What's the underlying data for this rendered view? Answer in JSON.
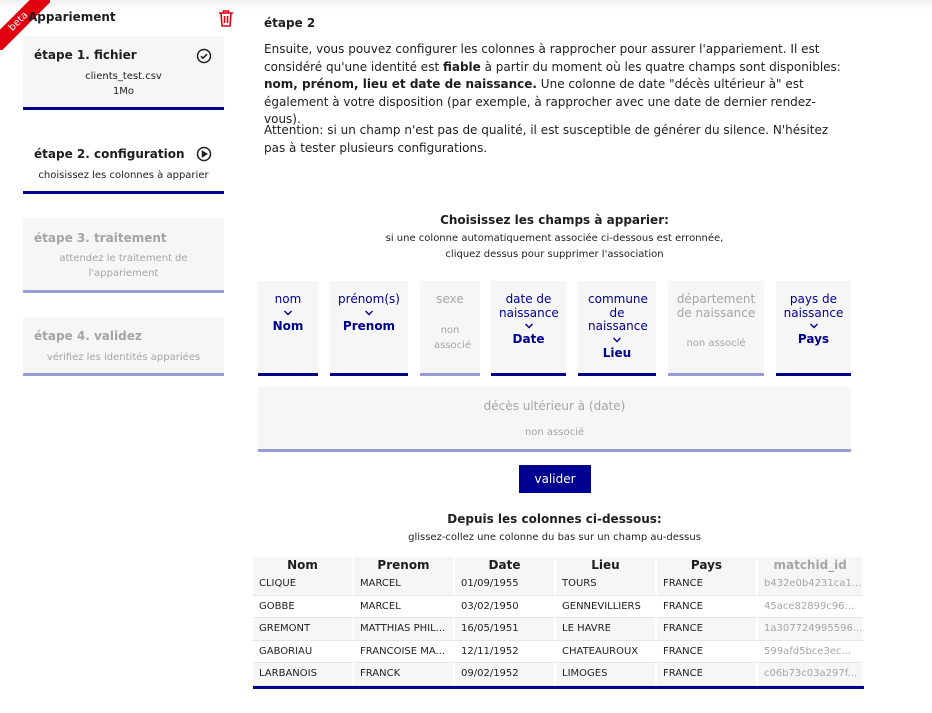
{
  "banner": {
    "beta": "beta"
  },
  "sidebar": {
    "title": "Appariement",
    "steps": [
      {
        "title": "étape 1. fichier",
        "line1": "clients_test.csv",
        "line2": "1Mo",
        "status": "done"
      },
      {
        "title": "étape 2. configuration",
        "line1": "choisissez les colonnes à apparier",
        "status": "active"
      },
      {
        "title": "étape 3. traitement",
        "line1": "attendez le traitement de",
        "line2": "l'appariement",
        "status": "todo"
      },
      {
        "title": "étape 4. validez",
        "line1": "vérifiez les identités appariées",
        "status": "todo"
      }
    ]
  },
  "main": {
    "title": "étape 2",
    "intro": {
      "before": "Ensuite, vous pouvez configurer les colonnes à rapprocher pour assurer l'appariement. Il est considéré qu'une identité est ",
      "bold1": "fiable",
      "middle": " à partir du moment où les quatre champs sont disponibles: ",
      "bold2": "nom, prénom, lieu et date de naissance.",
      "after": " Une colonne de date \"décès ultérieur à\" est également à votre disposition (par exemple, à rapprocher avec une date de dernier rendez-vous)."
    },
    "warning": "Attention: si un champ n'est pas de qualité, il est susceptible de générer du silence. N'hésitez pas à tester plusieurs configurations.",
    "choose_title": "Choisissez les champs à apparier:",
    "choose_sub1": "si une colonne automatiquement associée ci-dessous est erronnée,",
    "choose_sub2": "cliquez dessus pour supprimer l'association",
    "fields": [
      {
        "label": "nom",
        "value": "Nom"
      },
      {
        "label": "prénom(s)",
        "value": "Prenom"
      },
      {
        "label": "sexe",
        "value": "non associé"
      },
      {
        "label": "date de naissance",
        "value": "Date"
      },
      {
        "label": "commune de naissance",
        "value": "Lieu"
      },
      {
        "label": "département de naissance",
        "value": "non associé"
      },
      {
        "label": "pays de naissance",
        "value": "Pays"
      }
    ],
    "deces": {
      "label": "décès ultérieur à (date)",
      "value": "non associé"
    },
    "submit_label": "valider",
    "columns_title": "Depuis les colonnes ci-dessous:",
    "columns_sub": "glissez-collez une colonne du bas sur un champ au-dessus"
  },
  "table": {
    "headers": [
      "Nom",
      "Prenom",
      "Date",
      "Lieu",
      "Pays",
      "matchid_id"
    ],
    "rows": [
      [
        "CLIQUE",
        "MARCEL",
        "01/09/1955",
        "TOURS",
        "FRANCE",
        "b432e0b4231ca1..."
      ],
      [
        "GOBBE",
        "MARCEL",
        "03/02/1950",
        "GENNEVILLIERS",
        "FRANCE",
        "45ace82899c96..."
      ],
      [
        "GREMONT",
        "MATTHIAS PHIL...",
        "16/05/1951",
        "LE HAVRE",
        "FRANCE",
        "1a307724995596..."
      ],
      [
        "GABORIAU",
        "FRANCOISE MA...",
        "12/11/1952",
        "CHATEAUROUX",
        "FRANCE",
        "599afd5bce3ec..."
      ],
      [
        "LARBANOIS",
        "FRANCK",
        "09/02/1952",
        "LIMOGES",
        "FRANCE",
        "c06b73c03a297f..."
      ]
    ]
  },
  "colors": {
    "accent": "#000091",
    "accent_light": "#9a9ad6",
    "danger": "#e1000f",
    "muted": "#a5a5a5",
    "panel": "#f6f6f6"
  }
}
